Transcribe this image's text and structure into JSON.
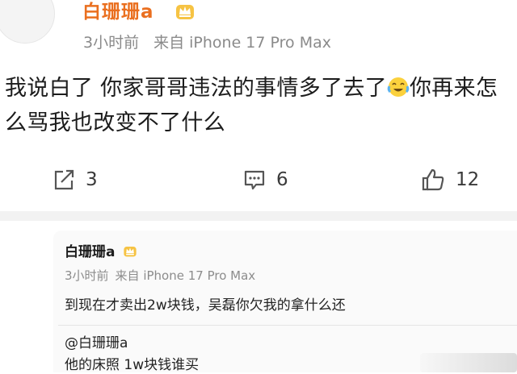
{
  "post": {
    "author": "白珊珊a",
    "time": "3小时前",
    "source": "来自 iPhone 17 Pro Max",
    "text_part1": "我说白了 你家哥哥违法的事情多了去了",
    "text_part2": "你再来怎么骂我也改变不了什么",
    "emoji": "laugh-cry-emoji"
  },
  "actions": {
    "repost_count": "3",
    "comment_count": "6",
    "like_count": "12"
  },
  "comment": {
    "author": "白珊珊a",
    "time": "3小时前",
    "source": "来自 iPhone 17 Pro Max",
    "text": "到现在才卖出2w块钱，吴磊你欠我的拿什么还",
    "quote_author": "@白珊珊a",
    "quote_text": "他的床照 1w块钱谁买"
  },
  "colors": {
    "name": "#ea6f1f",
    "meta": "#8a8a8a",
    "card": "#fafafa"
  }
}
